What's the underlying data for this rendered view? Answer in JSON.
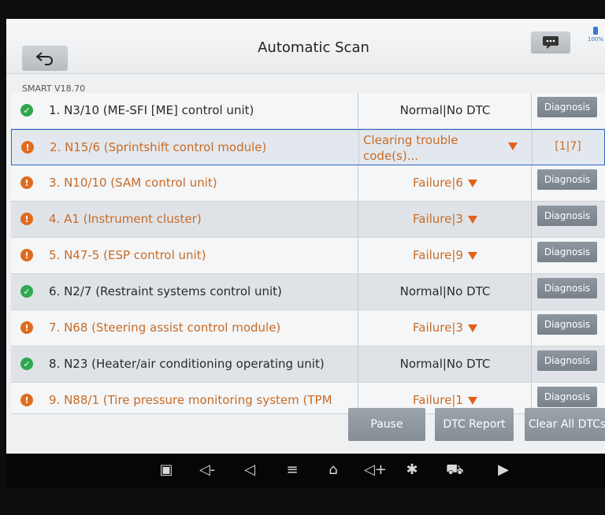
{
  "header": {
    "title": "Automatic Scan",
    "back_icon": "back-arrow-icon",
    "message_icon": "message-icon",
    "battery_level": "100%"
  },
  "version": "SMART V18.70",
  "rows": [
    {
      "name": "1. N3/10 (ME-SFI [ME] control unit)",
      "status": "Normal|No DTC",
      "state": "ok",
      "action": "Diagnosis"
    },
    {
      "name": "2. N15/6 (Sprintshift control module)",
      "status": "Clearing trouble code(s)...",
      "state": "err",
      "action": "[1|7]"
    },
    {
      "name": "3. N10/10 (SAM control unit)",
      "status": "Failure|6",
      "state": "err",
      "action": "Diagnosis"
    },
    {
      "name": "4. A1 (Instrument cluster)",
      "status": "Failure|3",
      "state": "err",
      "action": "Diagnosis"
    },
    {
      "name": "5. N47-5 (ESP control unit)",
      "status": "Failure|9",
      "state": "err",
      "action": "Diagnosis"
    },
    {
      "name": "6. N2/7 (Restraint systems control unit)",
      "status": "Normal|No DTC",
      "state": "ok",
      "action": "Diagnosis"
    },
    {
      "name": "7. N68 (Steering assist control module)",
      "status": "Failure|3",
      "state": "err",
      "action": "Diagnosis"
    },
    {
      "name": "8. N23 (Heater/air conditioning operating unit)",
      "status": "Normal|No DTC",
      "state": "ok",
      "action": "Diagnosis"
    },
    {
      "name": "9. N88/1 (Tire pressure monitoring system (TPM",
      "status": "Failure|1",
      "state": "err",
      "action": "Diagnosis"
    }
  ],
  "buttons": {
    "pause": "Pause",
    "dtc_report": "DTC Report",
    "clear_all": "Clear All DTCs"
  },
  "colors": {
    "ok": "#2fa84f",
    "failure": "#e06b1f",
    "failure_text": "#c96b25",
    "selection_border": "#2d64c8"
  },
  "navbar_icons": [
    "gallery-icon",
    "volume-down-icon",
    "back-icon",
    "menu-icon",
    "home-icon",
    "volume-up-icon",
    "bluetooth-icon",
    "vci-icon",
    "screen-record-icon"
  ]
}
